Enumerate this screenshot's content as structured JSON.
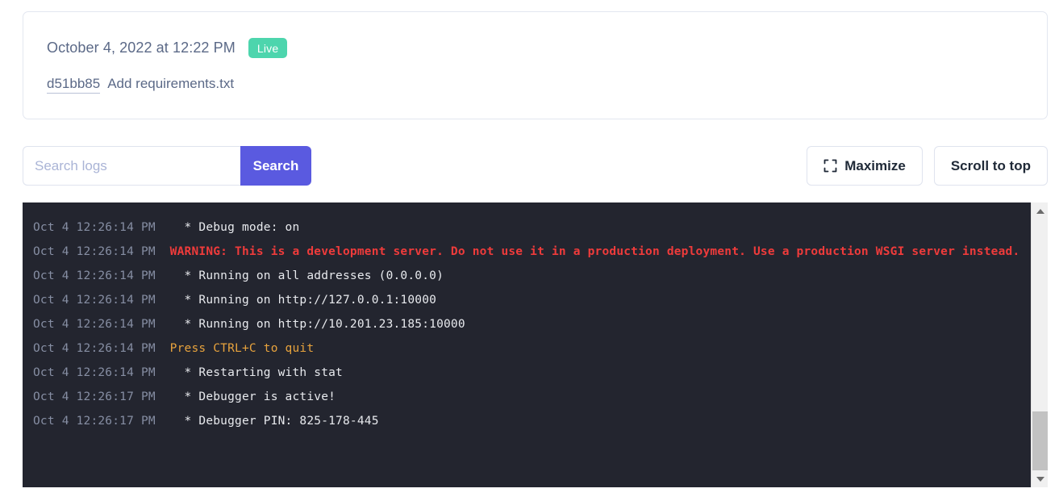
{
  "deploy": {
    "timestamp": "October 4, 2022 at 12:22 PM",
    "status_badge": "Live",
    "commit_hash": "d51bb85",
    "commit_message": "Add requirements.txt",
    "badge_color": "#4dd5ad"
  },
  "toolbar": {
    "search_placeholder": "Search logs",
    "search_value": "",
    "search_button_label": "Search",
    "search_button_color": "#5a5ae0",
    "maximize_label": "Maximize",
    "maximize_icon": "fullscreen-icon",
    "scroll_to_top_label": "Scroll to top"
  },
  "console": {
    "background_color": "#23252f",
    "timestamp_color": "#868ea3",
    "info_color": "#e8eaee",
    "error_color": "#ef3b3b",
    "warn_color": "#e8a33d",
    "lines": [
      {
        "timestamp": "Oct 4 12:26:14 PM",
        "message": "  * Debug mode: on",
        "level": "info"
      },
      {
        "timestamp": "Oct 4 12:26:14 PM",
        "message": "WARNING: This is a development server. Do not use it in a production deployment. Use a production WSGI server instead.",
        "level": "error"
      },
      {
        "timestamp": "Oct 4 12:26:14 PM",
        "message": "  * Running on all addresses (0.0.0.0)",
        "level": "info"
      },
      {
        "timestamp": "Oct 4 12:26:14 PM",
        "message": "  * Running on http://127.0.0.1:10000",
        "level": "info"
      },
      {
        "timestamp": "Oct 4 12:26:14 PM",
        "message": "  * Running on http://10.201.23.185:10000",
        "level": "info"
      },
      {
        "timestamp": "Oct 4 12:26:14 PM",
        "message": "Press CTRL+C to quit",
        "level": "warn"
      },
      {
        "timestamp": "Oct 4 12:26:14 PM",
        "message": "  * Restarting with stat",
        "level": "info"
      },
      {
        "timestamp": "Oct 4 12:26:17 PM",
        "message": "  * Debugger is active!",
        "level": "info"
      },
      {
        "timestamp": "Oct 4 12:26:17 PM",
        "message": "  * Debugger PIN: 825-178-445",
        "level": "info"
      }
    ]
  },
  "scrollbar": {
    "up_arrow": "chevron-up-icon",
    "down_arrow": "chevron-down-icon"
  }
}
